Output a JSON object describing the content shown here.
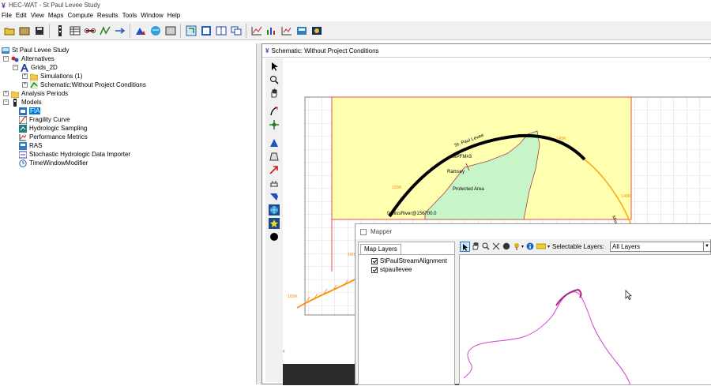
{
  "window": {
    "title": "HEC-WAT - St Paul Levee Study"
  },
  "menu": [
    "File",
    "Edit",
    "View",
    "Maps",
    "Compute",
    "Results",
    "Tools",
    "Window",
    "Help"
  ],
  "tree": {
    "root": "St Paul Levee Study",
    "alternatives": "Alternatives",
    "grids": "Grids_2D",
    "simulations": "Simulations (1)",
    "schematic": "Schematic:Without Project Conditions",
    "analysis": "Analysis Periods",
    "models": "Models",
    "model_items": [
      "FIA",
      "Fragility Curve",
      "Hydrologic Sampling",
      "Performance Metrics",
      "RAS",
      "Stochastic Hydrologic Data Importer",
      "TimeWindowModifier"
    ]
  },
  "schematic": {
    "title": "Schematic: Without Project Conditions",
    "labels": {
      "levee": "St. Paul Levee",
      "pfm": "StPFM#3",
      "ramsey": "Ramsey",
      "protected": "Protected Area",
      "river": "0 MissRiver@156700.0",
      "k145": "145K",
      "k155": "155K",
      "k140": "140K",
      "k165": "165K",
      "k160": "160",
      "miss": "Miss Riv"
    }
  },
  "mapper": {
    "title": "Mapper",
    "tab": "Map Layers",
    "layers": [
      "StPaulStreamAlignment",
      "stpaullevee"
    ],
    "selectable_label": "Selectable Layers:",
    "selectable_value": "All Layers"
  },
  "colors": {
    "accent": "#0078d7",
    "aoi": "#ffffb0",
    "aoi_border": "#e05050",
    "protected": "#c8f5c8",
    "river": "#ff8c00",
    "levee": "#000000",
    "mapline": "#cc44cc"
  }
}
